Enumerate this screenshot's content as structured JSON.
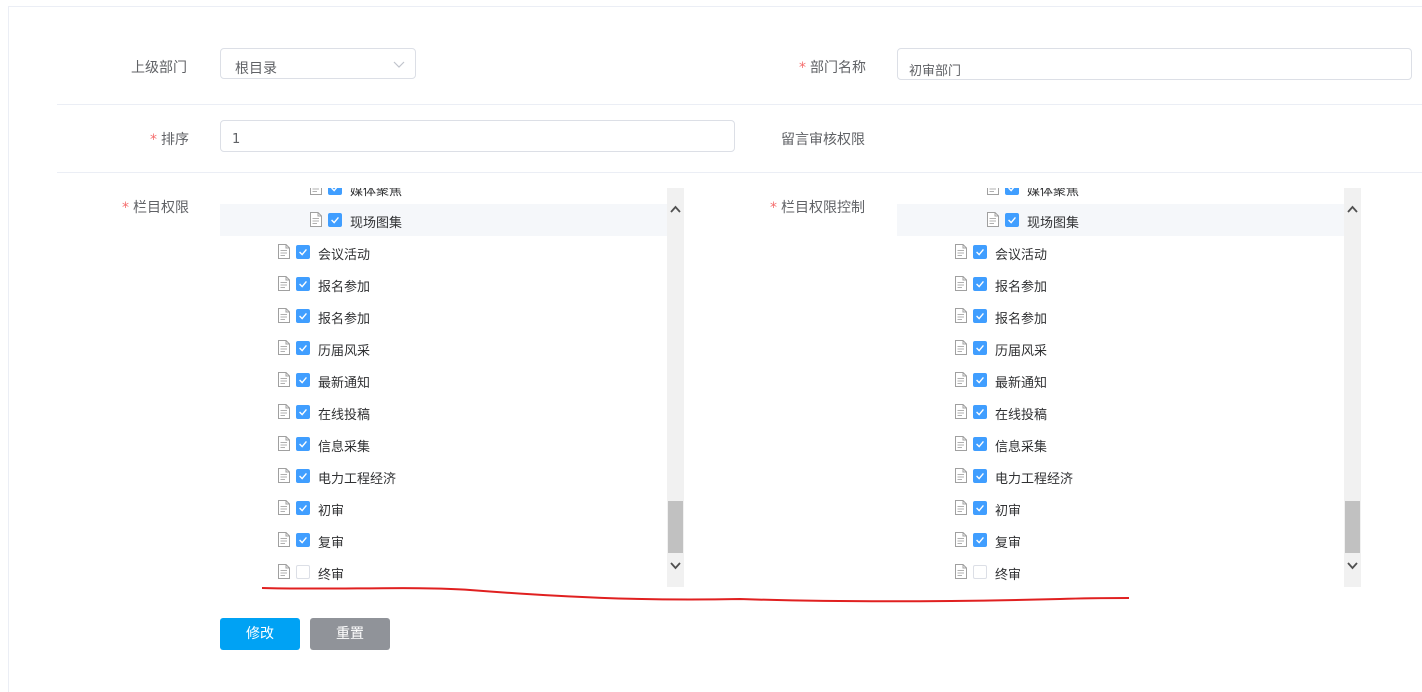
{
  "form": {
    "parent_label": "上级部门",
    "parent_value": "根目录",
    "dept_name_label": "部门名称",
    "dept_name_value": "初审部门",
    "order_label": "排序",
    "order_value": "1",
    "review_perm_label": "留言审核权限",
    "column_perm_label": "栏目权限",
    "column_perm_ctrl_label": "栏目权限控制",
    "required_mark": "*"
  },
  "tree_top": [
    {
      "label": "媒体聚焦",
      "checked": true
    },
    {
      "label": "现场图集",
      "checked": true
    }
  ],
  "tree_items": [
    {
      "label": "会议活动",
      "checked": true
    },
    {
      "label": "报名参加",
      "checked": true
    },
    {
      "label": "报名参加",
      "checked": true
    },
    {
      "label": "历届风采",
      "checked": true
    },
    {
      "label": "最新通知",
      "checked": true
    },
    {
      "label": "在线投稿",
      "checked": true
    },
    {
      "label": "信息采集",
      "checked": true
    },
    {
      "label": "电力工程经济",
      "checked": true
    },
    {
      "label": "初审",
      "checked": true
    },
    {
      "label": "复审",
      "checked": true
    },
    {
      "label": "终审",
      "checked": false
    }
  ],
  "buttons": {
    "submit_label": "修改",
    "reset_label": "重置"
  },
  "colors": {
    "accent": "#409eff",
    "primary_button": "#00a2f4",
    "annotation_red": "#e02020"
  }
}
